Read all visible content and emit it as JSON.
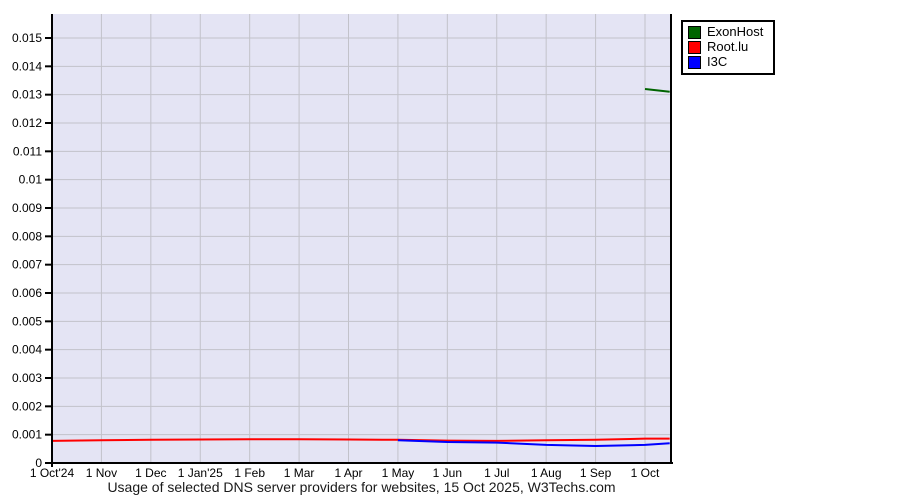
{
  "chart_data": {
    "type": "line",
    "title": "Usage of selected DNS server providers for websites, 15 Oct 2025, W3Techs.com",
    "x_axis": {
      "tick_labels": [
        "1 Oct'24",
        "1 Nov",
        "1 Dec",
        "1 Jan'25",
        "1 Feb",
        "1 Mar",
        "1 Apr",
        "1 May",
        "1 Jun",
        "1 Jul",
        "1 Aug",
        "1 Sep",
        "1 Oct"
      ],
      "tick_positions_months": [
        0,
        1,
        2,
        3,
        4,
        5,
        6,
        7,
        8,
        9,
        10,
        11,
        12
      ],
      "x_end_months": 12.5,
      "x_end_date": "15 Oct 2025"
    },
    "y_axis": {
      "min": 0,
      "max": 0.0158,
      "tick_step": 0.001,
      "tick_values": [
        0,
        0.001,
        0.002,
        0.003,
        0.004,
        0.005,
        0.006,
        0.007,
        0.008,
        0.009,
        0.01,
        0.011,
        0.012,
        0.013,
        0.014,
        0.015
      ],
      "tick_labels_top_down": [
        "0.015",
        "0.014",
        "0.013",
        "0.012",
        "0.011",
        "0.01",
        "0.009",
        "0.008",
        "0.007",
        "0.006",
        "0.005",
        "0.004",
        "0.003",
        "0.002",
        "0.001",
        "0"
      ]
    },
    "grid": true,
    "legend_position": "outside-top-right",
    "colors": {
      "plot_background": "#e4e4f4",
      "grid_line": "#c2c2ca",
      "axis_line": "#000000",
      "page_background": "#ffffff"
    },
    "series": [
      {
        "name": "ExonHost",
        "color": "#006400",
        "points_months_value": [
          [
            12,
            0.0132
          ],
          [
            12.5,
            0.0131
          ]
        ]
      },
      {
        "name": "Root.lu",
        "color": "#ff0000",
        "points_months_value": [
          [
            0,
            0.00078
          ],
          [
            1,
            0.0008
          ],
          [
            2,
            0.00082
          ],
          [
            3,
            0.00083
          ],
          [
            4,
            0.00084
          ],
          [
            5,
            0.00084
          ],
          [
            6,
            0.00083
          ],
          [
            7,
            0.00082
          ],
          [
            8,
            0.00079
          ],
          [
            9,
            0.00078
          ],
          [
            10,
            0.0008
          ],
          [
            11,
            0.00082
          ],
          [
            12,
            0.00086
          ],
          [
            12.5,
            0.00086
          ]
        ]
      },
      {
        "name": "I3C",
        "color": "#0000ff",
        "points_months_value": [
          [
            7,
            0.0008
          ],
          [
            8,
            0.00074
          ],
          [
            9,
            0.00072
          ],
          [
            10,
            0.00064
          ],
          [
            11,
            0.0006
          ],
          [
            12,
            0.00064
          ],
          [
            12.5,
            0.0007
          ]
        ]
      }
    ]
  }
}
